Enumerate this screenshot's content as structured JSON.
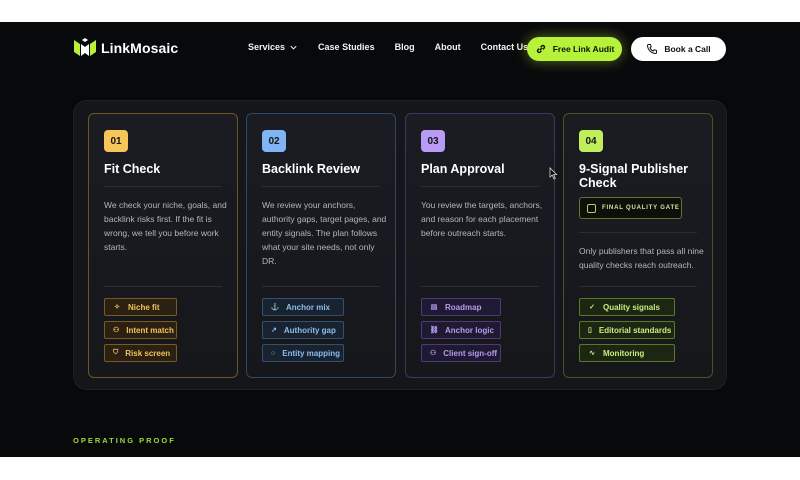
{
  "brand": {
    "name": "LinkMosaic"
  },
  "nav": {
    "items": [
      {
        "label": "Services",
        "has_dropdown": true
      },
      {
        "label": "Case Studies"
      },
      {
        "label": "Blog"
      },
      {
        "label": "About"
      },
      {
        "label": "Contact Us"
      }
    ],
    "audit_button": "Free Link Audit",
    "call_button": "Book a Call"
  },
  "colors": {
    "accent": "#b6f23a",
    "step1": "#f6c659",
    "step2": "#7fb5f5",
    "step3": "#b89bf6",
    "step4": "#bff05c"
  },
  "steps": [
    {
      "number": "01",
      "title": "Fit Check",
      "description": "We check your niche, goals, and backlink risks first. If the fit is wrong, we tell you before work starts.",
      "chips": [
        {
          "label": "Niche fit",
          "icon": "sparkle-icon"
        },
        {
          "label": "Intent match",
          "icon": "users-icon"
        },
        {
          "label": "Risk screen",
          "icon": "shield-icon"
        }
      ]
    },
    {
      "number": "02",
      "title": "Backlink Review",
      "description": "We review your anchors, authority gaps, target pages, and entity signals. The plan follows what your site needs, not only DR.",
      "chips": [
        {
          "label": "Anchor mix",
          "icon": "anchor-icon"
        },
        {
          "label": "Authority gap",
          "icon": "chart-icon"
        },
        {
          "label": "Entity mapping",
          "icon": "search-icon"
        }
      ]
    },
    {
      "number": "03",
      "title": "Plan Approval",
      "description": "You review the targets, anchors, and reason for each placement before outreach starts.",
      "chips": [
        {
          "label": "Roadmap",
          "icon": "map-icon"
        },
        {
          "label": "Anchor logic",
          "icon": "link-icon"
        },
        {
          "label": "Client sign-off",
          "icon": "users-icon"
        }
      ]
    },
    {
      "number": "04",
      "title": "9-Signal Publisher Check",
      "badge": "FINAL QUALITY GATE",
      "description": "Only publishers that pass all nine quality checks reach outreach.",
      "chips": [
        {
          "label": "Quality signals",
          "icon": "check-icon"
        },
        {
          "label": "Editorial standards",
          "icon": "document-icon"
        },
        {
          "label": "Monitoring",
          "icon": "pulse-icon"
        }
      ]
    }
  ],
  "section_label": "OPERATING PROOF"
}
